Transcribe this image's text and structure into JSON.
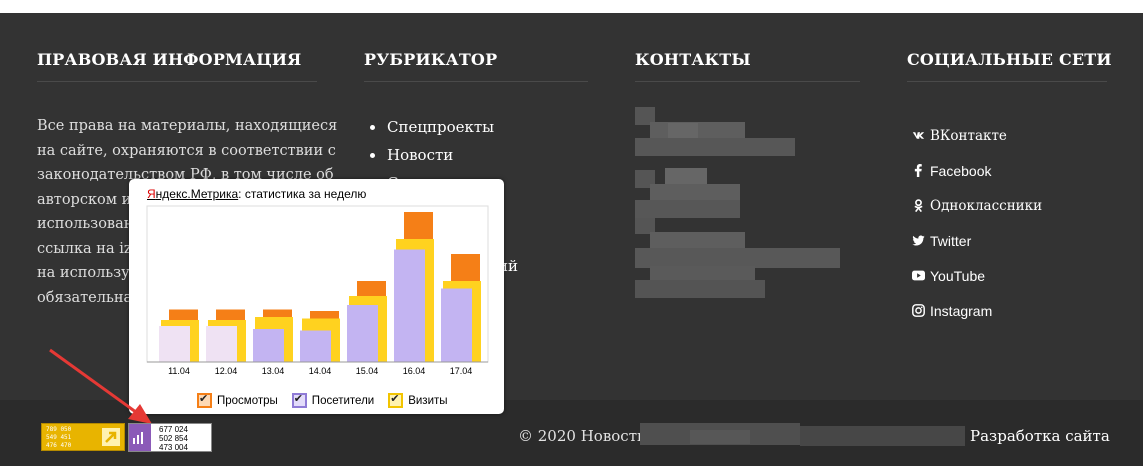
{
  "headings": {
    "legal": "ПРАВОВАЯ ИНФОРМАЦИЯ",
    "rubricator": "РУБРИКАТОР",
    "contacts": "КОНТАКТЫ",
    "social": "СОЦИАЛЬНЫЕ СЕТИ"
  },
  "legal_text": [
    "Все права на материалы, находящиеся",
    "на сайте, охраняются в соответствии с",
    "законодательством РФ, в том числе об",
    "авторском и с",
    "использовани",
    "ссылка на izv",
    "на используе",
    "обязательна."
  ],
  "rubricator": {
    "items": [
      "Спецпроекты",
      "Новости",
      "С"
    ],
    "tail": "ий"
  },
  "social": [
    {
      "icon": "vk-icon",
      "label": "ВКонтакте"
    },
    {
      "icon": "facebook-icon",
      "label": "Facebook"
    },
    {
      "icon": "odnoklassniki-icon",
      "label": "Одноклассники"
    },
    {
      "icon": "twitter-icon",
      "label": "Twitter"
    },
    {
      "icon": "youtube-icon",
      "label": "YouTube"
    },
    {
      "icon": "instagram-icon",
      "label": "Instagram"
    }
  ],
  "metrica": {
    "brand": "Яндекс.Метрика",
    "brand_first_letter": "Я",
    "brand_rest": "ндекс.Метрика",
    "subtitle": ": статистика за неделю",
    "legend": [
      "Просмотры",
      "Посетители",
      "Визиты"
    ]
  },
  "chart_data": {
    "type": "bar",
    "title": "",
    "categories": [
      "11.04",
      "12.04",
      "13.04",
      "14.04",
      "15.04",
      "16.04",
      "17.04"
    ],
    "series": [
      {
        "name": "Просмотры",
        "values": [
          35,
          35,
          35,
          34,
          54,
          100,
          72
        ]
      },
      {
        "name": "Визиты",
        "values": [
          28,
          28,
          30,
          29,
          44,
          82,
          54
        ]
      },
      {
        "name": "Посетители",
        "values": [
          24,
          24,
          22,
          21,
          38,
          75,
          49
        ]
      }
    ],
    "ylim": [
      0,
      100
    ],
    "colors": {
      "Просмотры": "#f57f17",
      "Визиты": "#ffd21f",
      "Посетители": "#c3b4f2",
      "weekend_visitors": "#efe2f3"
    },
    "legend": "bottom"
  },
  "counter_liveinternet": {
    "lines": [
      "789 050",
      "549 451",
      "476 470"
    ]
  },
  "counter_metrica": {
    "lines": [
      "677 024",
      "502 854",
      "473 004"
    ]
  },
  "copyright": "© 2020 Новости",
  "dev_link": "Разработка сайта",
  "colors": {
    "background": "#333333",
    "bottom": "#2b2b2b",
    "heading": "#ffffff"
  }
}
